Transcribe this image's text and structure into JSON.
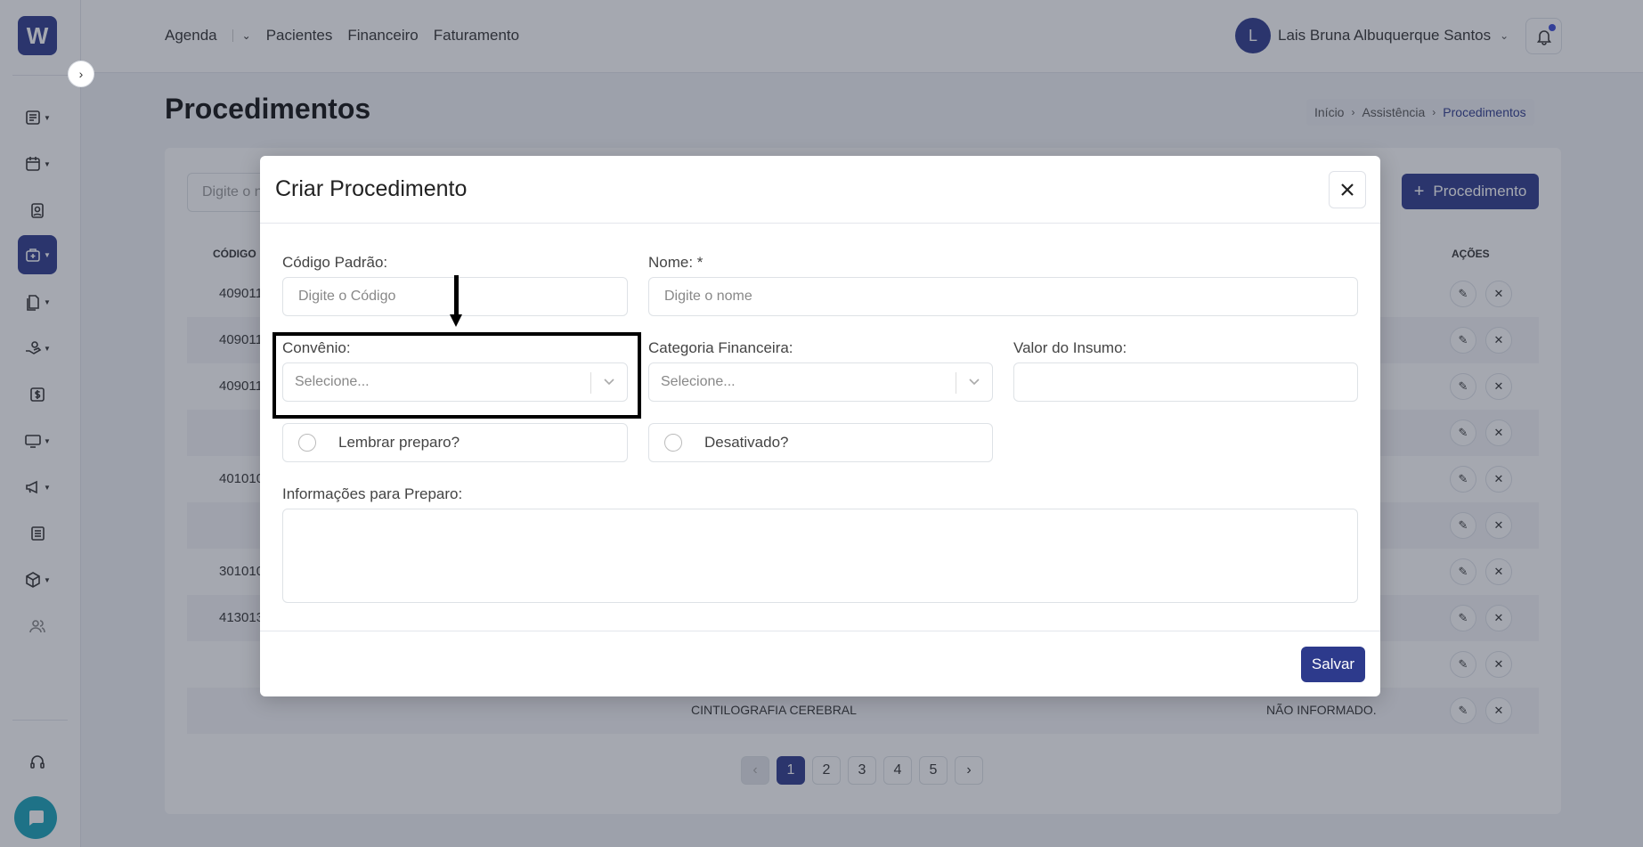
{
  "sidebar": {
    "logo_text": "W",
    "items": [
      "list-icon",
      "calendar-icon",
      "badge-icon",
      "medical-bag-icon",
      "documents-icon",
      "hand-money-icon",
      "dollar-icon",
      "monitor-icon",
      "megaphone-icon",
      "newspaper-icon",
      "box-icon",
      "users-icon"
    ],
    "support_icon": "headset-icon",
    "chat_icon": "chat-icon"
  },
  "header": {
    "nav": [
      "Agenda",
      "Pacientes",
      "Financeiro",
      "Faturamento"
    ],
    "user_initial": "L",
    "user_name": "Lais Bruna Albuquerque Santos"
  },
  "page": {
    "title": "Procedimentos",
    "breadcrumb": [
      "Início",
      "Assistência",
      "Procedimentos"
    ],
    "search_placeholder": "Digite o n",
    "add_button": "Procedimento",
    "columns": {
      "code": "CÓDIGO",
      "actions": "AÇÕES"
    },
    "rows": [
      {
        "code": "409011",
        "name": "",
        "conv": ""
      },
      {
        "code": "409011",
        "name": "",
        "conv": ""
      },
      {
        "code": "409011",
        "name": "",
        "conv": ""
      },
      {
        "code": "",
        "name": "",
        "conv": ""
      },
      {
        "code": "401010",
        "name": "",
        "conv": ""
      },
      {
        "code": "",
        "name": "",
        "conv": ""
      },
      {
        "code": "301010",
        "name": "",
        "conv": ""
      },
      {
        "code": "413013",
        "name": "",
        "conv": ""
      },
      {
        "code": "",
        "name": "",
        "conv": ""
      },
      {
        "code": "",
        "name": "CINTILOGRAFIA CEREBRAL",
        "conv": "NÃO INFORMADO."
      }
    ],
    "pagination": [
      "1",
      "2",
      "3",
      "4",
      "5"
    ],
    "current_page": "1"
  },
  "modal": {
    "title": "Criar Procedimento",
    "codigo_label": "Código Padrão:",
    "codigo_placeholder": "Digite o Código",
    "nome_label": "Nome: *",
    "nome_placeholder": "Digite o nome",
    "convenio_label": "Convênio:",
    "convenio_placeholder": "Selecione...",
    "categoria_label": "Categoria Financeira:",
    "categoria_placeholder": "Selecione...",
    "valor_label": "Valor do Insumo:",
    "lembrar_label": "Lembrar preparo?",
    "desativado_label": "Desativado?",
    "info_label": "Informações para Preparo:",
    "save_label": "Salvar"
  },
  "colors": {
    "primary": "#2d3a8c",
    "chat": "#17a2b8"
  }
}
